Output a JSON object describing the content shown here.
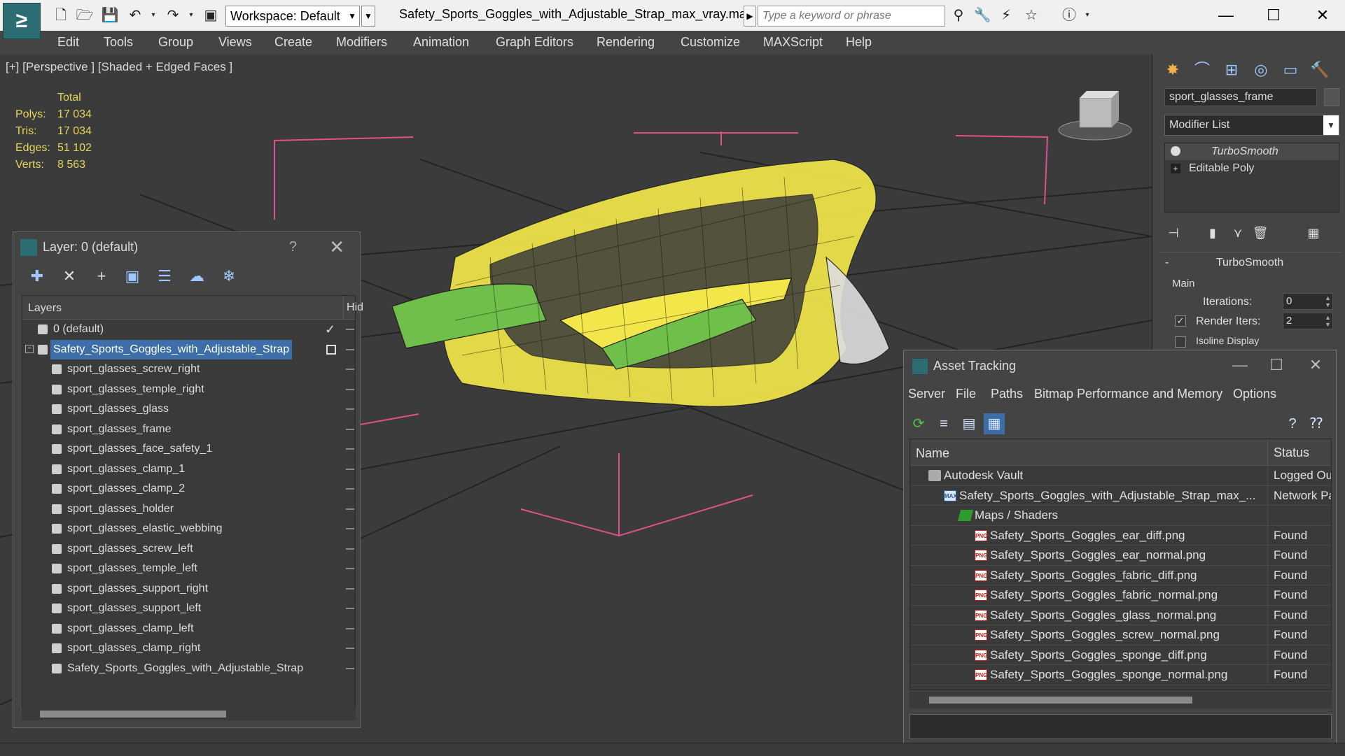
{
  "titlebar": {
    "workspace": "Workspace: Default",
    "file_title": "Safety_Sports_Goggles_with_Adjustable_Strap_max_vray.max",
    "search_placeholder": "Type a keyword or phrase"
  },
  "menu": {
    "items": [
      "Edit",
      "Tools",
      "Group",
      "Views",
      "Create",
      "Modifiers",
      "Animation",
      "Graph Editors",
      "Rendering",
      "Customize",
      "MAXScript",
      "Help"
    ]
  },
  "viewport": {
    "label": "[+] [Perspective ] [Shaded + Edged Faces ]",
    "stats": {
      "header": "Total",
      "rows": [
        {
          "k": "Polys:",
          "v": "17 034"
        },
        {
          "k": "Tris:",
          "v": "17 034"
        },
        {
          "k": "Edges:",
          "v": "51 102"
        },
        {
          "k": "Verts:",
          "v": "8 563"
        }
      ]
    }
  },
  "layer_dialog": {
    "title": "Layer: 0 (default)",
    "help": "?",
    "col_layers": "Layers",
    "col_hide": "Hid",
    "rows": [
      {
        "name": "0 (default)",
        "level": 1,
        "selected": false
      },
      {
        "name": "Safety_Sports_Goggles_with_Adjustable_Strap",
        "level": 1,
        "selected": true
      },
      {
        "name": "sport_glasses_screw_right",
        "level": 2
      },
      {
        "name": "sport_glasses_temple_right",
        "level": 2
      },
      {
        "name": "sport_glasses_glass",
        "level": 2
      },
      {
        "name": "sport_glasses_frame",
        "level": 2
      },
      {
        "name": "sport_glasses_face_safety_1",
        "level": 2
      },
      {
        "name": "sport_glasses_clamp_1",
        "level": 2
      },
      {
        "name": "sport_glasses_clamp_2",
        "level": 2
      },
      {
        "name": "sport_glasses_holder",
        "level": 2
      },
      {
        "name": "sport_glasses_elastic_webbing",
        "level": 2
      },
      {
        "name": "sport_glasses_screw_left",
        "level": 2
      },
      {
        "name": "sport_glasses_temple_left",
        "level": 2
      },
      {
        "name": "sport_glasses_support_right",
        "level": 2
      },
      {
        "name": "sport_glasses_support_left",
        "level": 2
      },
      {
        "name": "sport_glasses_clamp_left",
        "level": 2
      },
      {
        "name": "sport_glasses_clamp_right",
        "level": 2
      },
      {
        "name": "Safety_Sports_Goggles_with_Adjustable_Strap",
        "level": 2
      }
    ]
  },
  "command_panel": {
    "object_name": "sport_glasses_frame",
    "modifier_list": "Modifier List",
    "stack": [
      "TurboSmooth",
      "Editable Poly"
    ],
    "rollout_title": "TurboSmooth",
    "main_label": "Main",
    "iterations_label": "Iterations:",
    "iterations_value": "0",
    "render_iters_label": "Render Iters:",
    "render_iters_value": "2",
    "isoline_label": "Isoline Display"
  },
  "asset_tracking": {
    "title": "Asset Tracking",
    "menu": [
      "Server",
      "File",
      "Paths",
      "Bitmap Performance and Memory",
      "Options"
    ],
    "col_name": "Name",
    "col_status": "Status",
    "rows": [
      {
        "name": "Autodesk Vault",
        "status": "Logged Ou",
        "indent": 1,
        "icon": "vault"
      },
      {
        "name": "Safety_Sports_Goggles_with_Adjustable_Strap_max_...",
        "status": "Network Pa",
        "indent": 2,
        "icon": "max"
      },
      {
        "name": "Maps / Shaders",
        "status": "",
        "indent": 3,
        "icon": "map"
      },
      {
        "name": "Safety_Sports_Goggles_ear_diff.png",
        "status": "Found",
        "indent": 4,
        "icon": "png"
      },
      {
        "name": "Safety_Sports_Goggles_ear_normal.png",
        "status": "Found",
        "indent": 4,
        "icon": "png"
      },
      {
        "name": "Safety_Sports_Goggles_fabric_diff.png",
        "status": "Found",
        "indent": 4,
        "icon": "png"
      },
      {
        "name": "Safety_Sports_Goggles_fabric_normal.png",
        "status": "Found",
        "indent": 4,
        "icon": "png"
      },
      {
        "name": "Safety_Sports_Goggles_glass_normal.png",
        "status": "Found",
        "indent": 4,
        "icon": "png"
      },
      {
        "name": "Safety_Sports_Goggles_screw_normal.png",
        "status": "Found",
        "indent": 4,
        "icon": "png"
      },
      {
        "name": "Safety_Sports_Goggles_sponge_diff.png",
        "status": "Found",
        "indent": 4,
        "icon": "png"
      },
      {
        "name": "Safety_Sports_Goggles_sponge_normal.png",
        "status": "Found",
        "indent": 4,
        "icon": "png"
      }
    ]
  },
  "colors": {
    "viewport_bg": "#3b3b3b",
    "stats_text": "#e5d55a",
    "selection": "#3d6ea8",
    "wire_yellow": "#f2e64a",
    "wire_green": "#6fbf4a"
  }
}
